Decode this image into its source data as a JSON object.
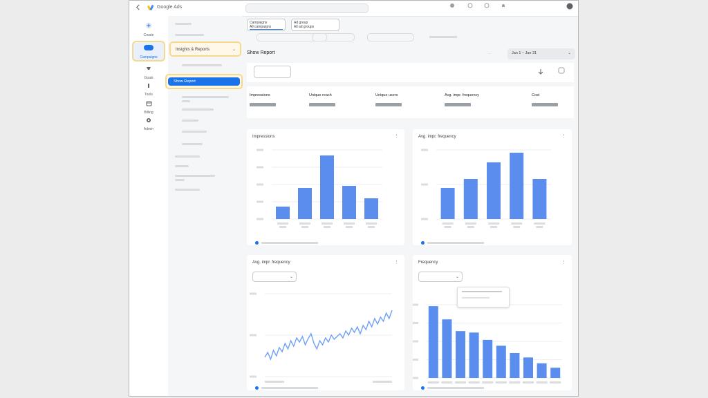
{
  "app": {
    "title": "Google Ads"
  },
  "nav_rail": [
    {
      "label": "Create",
      "icon": "plus-icon"
    },
    {
      "label": "Campaigns",
      "icon": "campaigns-icon"
    },
    {
      "label": "Goals",
      "icon": "trophy-icon"
    },
    {
      "label": "Tools",
      "icon": "tools-icon"
    },
    {
      "label": "Billing",
      "icon": "billing-icon"
    },
    {
      "label": "Admin",
      "icon": "gear-icon"
    }
  ],
  "left_nav": {
    "insights_label": "Insights & Reports",
    "active_item": "Show Report"
  },
  "filters": {
    "chip1_line1": "Campaigns",
    "chip1_line2": "All campaigns",
    "chip2_line1": "Ad group",
    "chip2_line2": "All ad groups"
  },
  "page": {
    "title": "Show Report",
    "date_range": "Jan 1 – Jan 31"
  },
  "metrics": [
    {
      "label": "Impressions"
    },
    {
      "label": "Unique reach"
    },
    {
      "label": "Unique users"
    },
    {
      "label": "Avg. impr. frequency"
    },
    {
      "label": "Cost"
    }
  ],
  "cards": {
    "impressions_title": "Impressions",
    "avg_frequency_title": "Avg. impr. frequency",
    "avg_frequency_line_title": "Avg. impr. frequency",
    "frequency_title": "Frequency"
  },
  "chart_data": [
    {
      "type": "bar",
      "name": "impressions",
      "values": [
        18,
        45,
        92,
        48,
        30
      ],
      "ylim": [
        0,
        100
      ],
      "color": "#5b8def"
    },
    {
      "type": "bar",
      "name": "avg-frequency",
      "values": [
        45,
        58,
        82,
        96,
        58
      ],
      "ylim": [
        0,
        100
      ],
      "color": "#5b8def"
    },
    {
      "type": "line",
      "name": "avg-frequency-over-time",
      "values": [
        28,
        35,
        25,
        38,
        30,
        42,
        36,
        48,
        40,
        52,
        44,
        56,
        50,
        58,
        46,
        55,
        62,
        48,
        40,
        52,
        46,
        56,
        50,
        60,
        54,
        58,
        62,
        56,
        66,
        60,
        70,
        64,
        72,
        62,
        74,
        68,
        80,
        72,
        84,
        76,
        86,
        80,
        92,
        84,
        96
      ],
      "ylim": [
        0,
        120
      ],
      "color": "#6ea1f5"
    },
    {
      "type": "bar",
      "name": "frequency",
      "values": [
        98,
        80,
        64,
        62,
        52,
        44,
        34,
        28,
        20,
        14
      ],
      "ylim": [
        0,
        100
      ],
      "color": "#5b8def"
    }
  ],
  "colors": {
    "accent": "#1a73e8",
    "bar": "#5b8def",
    "highlight": "#f6d98b"
  }
}
